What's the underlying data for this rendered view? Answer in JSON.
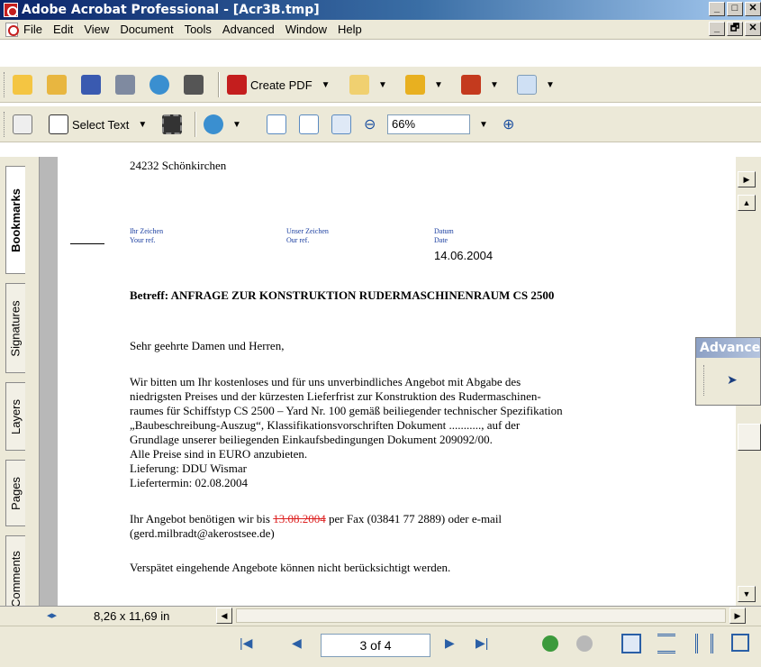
{
  "window": {
    "title": "Adobe Acrobat Professional - [Acr3B.tmp]",
    "minimize": "_",
    "maximize": "□",
    "close": "✕",
    "restore": "🗗"
  },
  "menu": [
    "File",
    "Edit",
    "View",
    "Document",
    "Tools",
    "Advanced",
    "Window",
    "Help"
  ],
  "toolbar1": {
    "create_pdf": "Create PDF"
  },
  "toolbar2": {
    "select_text": "Select Text",
    "zoom": "66%"
  },
  "sidebar": {
    "tabs": [
      "Bookmarks",
      "Signatures",
      "Layers",
      "Pages",
      "Comments"
    ],
    "active": "Bookmarks"
  },
  "document": {
    "address_line": "24232 Schönkirchen",
    "ref_labels": {
      "ihr": "Ihr Zeichen",
      "your": "Your ref.",
      "unser": "Unser Zeichen",
      "our": "Our ref.",
      "datum": "Datum",
      "date": "Date"
    },
    "date_value": "14.06.2004",
    "subject": "Betreff: ANFRAGE ZUR KONSTRUKTION RUDERMASCHINENRAUM CS 2500",
    "greeting": "Sehr geehrte Damen und Herren,",
    "paragraph": [
      "Wir bitten um Ihr kostenloses und für uns unverbindliches Angebot mit Abgabe des",
      "niedrigsten Preises und der kürzesten Lieferfrist zur Konstruktion des Rudermaschinen-",
      "raumes für Schiffstyp CS 2500 – Yard Nr. 100 gemäß beiliegender technischer Spezifikation",
      "„Baubeschreibung-Auszug“, Klassifikationsvorschriften Dokument ..........., auf der",
      "Grundlage unserer beiliegenden Einkaufsbedingungen Dokument 209092/00.",
      "Alle Preise sind in EURO anzubieten.",
      "Lieferung: DDU Wismar",
      "Liefertermin: 02.08.2004"
    ],
    "offer_prefix": "Ihr Angebot benötigen wir bis ",
    "offer_struck_date": "13.08.2004",
    "offer_suffix": " per Fax (03841 77 2889) oder e-mail",
    "offer_email": "(gerd.milbradt@akerostsee.de)",
    "late_note": "Verspätet eingehende Angebote können nicht berücksichtigt werden."
  },
  "advanced_panel": {
    "title": "Advanced"
  },
  "status": {
    "page_size": "8,26 x 11,69 in",
    "page_indicator": "3 of 4"
  }
}
